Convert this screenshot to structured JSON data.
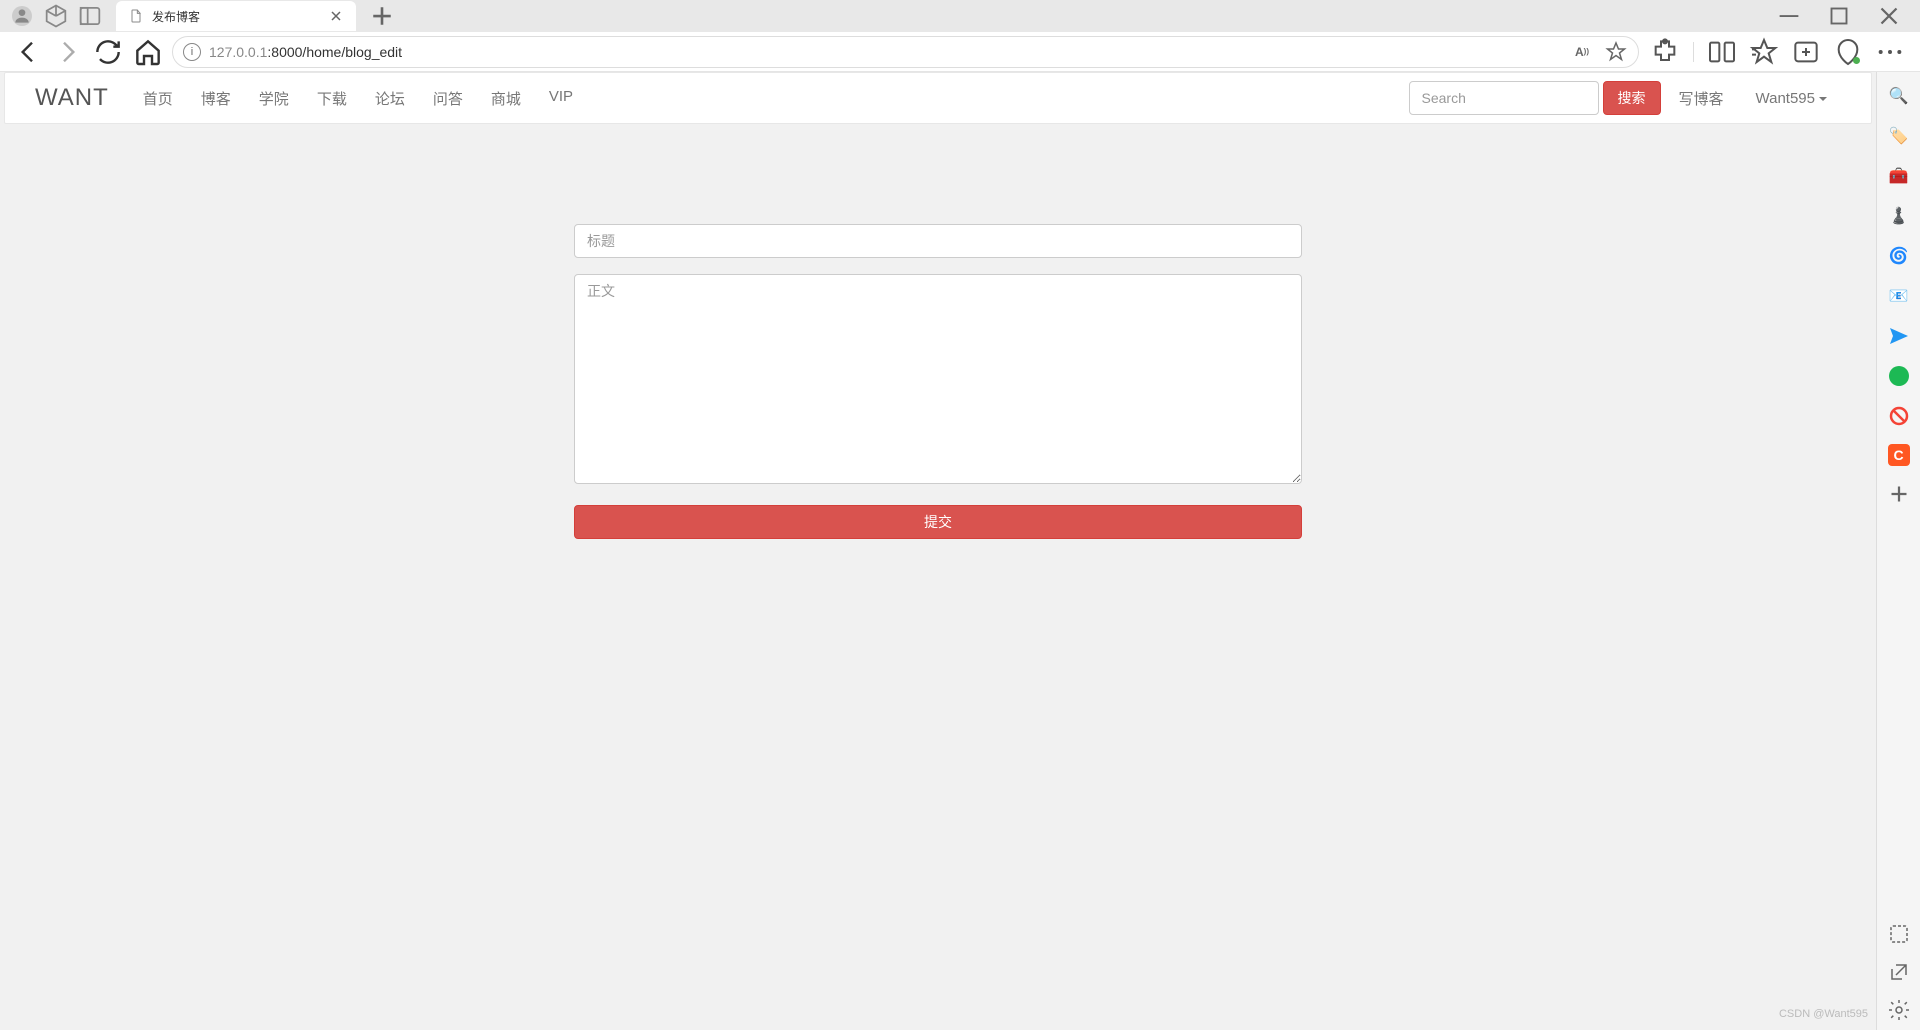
{
  "browser": {
    "tab_title": "发布博客",
    "url_host": "127.0.0.1",
    "url_port_path": ":8000/home/blog_edit"
  },
  "navbar": {
    "brand": "WANT",
    "links": [
      "首页",
      "博客",
      "学院",
      "下载",
      "论坛",
      "问答",
      "商城",
      "VIP"
    ],
    "search_placeholder": "Search",
    "search_button": "搜索",
    "write_blog": "写博客",
    "username": "Want595"
  },
  "form": {
    "title_placeholder": "标题",
    "body_placeholder": "正文",
    "submit_label": "提交"
  },
  "watermark": "CSDN @Want595"
}
